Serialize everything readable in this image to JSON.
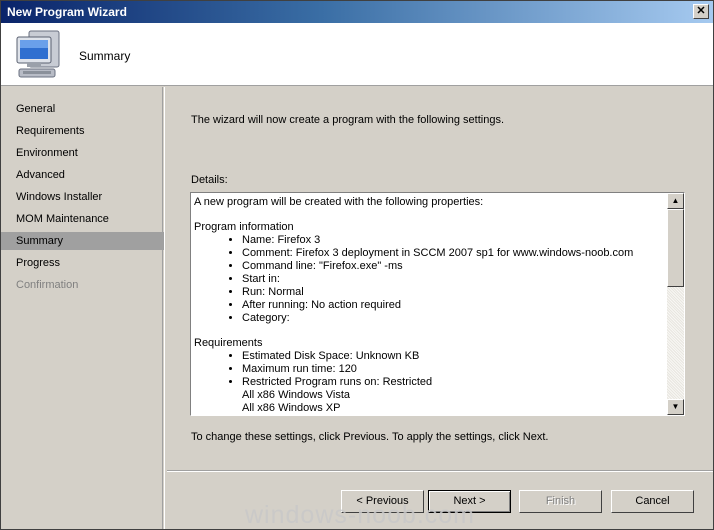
{
  "window": {
    "title": "New Program Wizard",
    "close_glyph": "✕"
  },
  "header": {
    "title": "Summary",
    "icon": "computer-icon"
  },
  "sidebar": {
    "items": [
      {
        "label": "General",
        "state": "normal"
      },
      {
        "label": "Requirements",
        "state": "normal"
      },
      {
        "label": "Environment",
        "state": "normal"
      },
      {
        "label": "Advanced",
        "state": "normal"
      },
      {
        "label": "Windows Installer",
        "state": "normal"
      },
      {
        "label": "MOM Maintenance",
        "state": "normal"
      },
      {
        "label": "Summary",
        "state": "selected"
      },
      {
        "label": "Progress",
        "state": "normal"
      },
      {
        "label": "Confirmation",
        "state": "disabled"
      }
    ]
  },
  "main": {
    "intro": "The wizard will now create a program with the following settings.",
    "details_label": "Details:",
    "details": {
      "first_line": "A new program will be created with the following properties:",
      "program_info_heading": "Program information",
      "program_info": [
        "Name: Firefox 3",
        "Comment: Firefox 3 deployment in SCCM 2007 sp1 for www.windows-noob.com",
        "Command line: \"Firefox.exe\" -ms",
        "Start in:",
        "Run: Normal",
        "After running: No action required",
        "Category:"
      ],
      "requirements_heading": "Requirements",
      "requirements": [
        "Estimated Disk Space: Unknown KB",
        "Maximum run time: 120",
        "Restricted Program runs on: Restricted"
      ],
      "platforms": [
        "All x86 Windows Vista",
        "All x86 Windows XP"
      ]
    },
    "apply_text": "To change these settings, click Previous. To apply the settings, click Next."
  },
  "buttons": {
    "previous": "< Previous",
    "next": "Next >",
    "finish": "Finish",
    "cancel": "Cancel"
  },
  "watermark": "windows-noob.com"
}
